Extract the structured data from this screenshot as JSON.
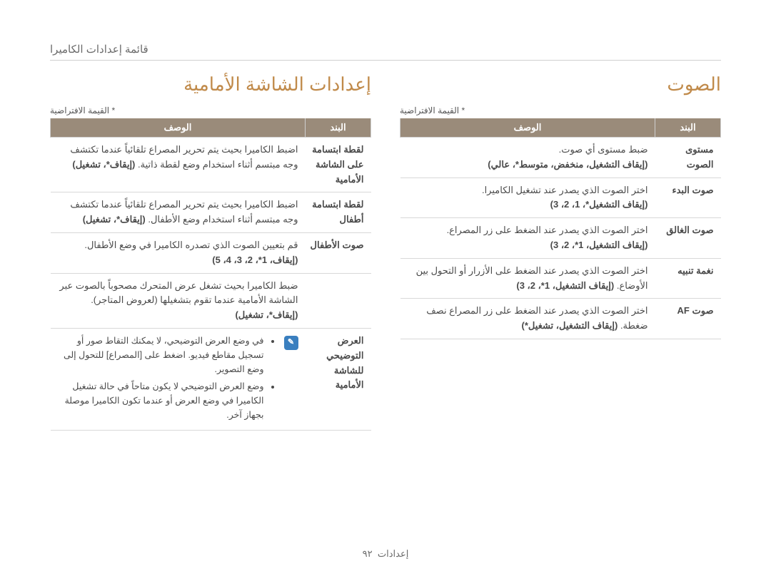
{
  "breadcrumb": "قائمة إعدادات الكاميرا",
  "default_note": "* القيمة الافتراضية",
  "headers": {
    "item": "البند",
    "desc": "الوصف"
  },
  "sound": {
    "title": "الصوت",
    "rows": [
      {
        "item": "مستوى الصوت",
        "desc": "ضبط مستوى أي صوت.",
        "options": "(إيقاف التشغيل، منخفض، متوسط*، عالي)"
      },
      {
        "item": "صوت البدء",
        "desc": "اختر الصوت الذي يصدر عند تشغيل الكاميرا.",
        "options": "(إيقاف التشغيل*، 1، 2، 3)"
      },
      {
        "item": "صوت الغالق",
        "desc": "اختر الصوت الذي يصدر عند الضغط على زر المصراع.",
        "options": "(إيقاف التشغيل، 1*، 2، 3)"
      },
      {
        "item": "نغمة تنبيه",
        "desc": "اختر الصوت الذي يصدر عند الضغط على الأزرار أو التحول بين الأوضاع.",
        "options": "(إيقاف التشغيل، 1*، 2، 3)"
      },
      {
        "item": "صوت AF",
        "desc": "اختر الصوت الذي يصدر عند الضغط على زر المصراع نصف ضغطة.",
        "options": "(إيقاف التشغيل، تشغيل*)"
      }
    ]
  },
  "front": {
    "title": "إعدادات الشاشة الأمامية",
    "rows": [
      {
        "item": "لقطة ابتسامة على الشاشة الأمامية",
        "desc": "اضبط الكاميرا بحيث يتم تحرير المصراع تلقائياً عندما تكتشف وجه مبتسم أثناء استخدام وضع لقطة ذاتية.",
        "options": "(إيقاف*، تشغيل)"
      },
      {
        "item": "لقطة ابتسامة أطفال",
        "desc": "اضبط الكاميرا بحيث يتم تحرير المصراع تلقائياً عندما تكتشف وجه مبتسم أثناء استخدام وضع الأطفال.",
        "options": "(إيقاف*، تشغيل)"
      },
      {
        "item": "صوت الأطفال",
        "desc": "قم بتعيين الصوت الذي تصدره الكاميرا في وضع الأطفال.",
        "options": "(إيقاف، 1*، 2، 3، 4، 5)"
      },
      {
        "item_blank": true,
        "desc": "ضبط الكاميرا بحيث تشغل عرض المتحرك مصحوباً بالصوت عبر الشاشة الأمامية عندما تقوم بتشغيلها (لعروض المتاجر).",
        "options": "(إيقاف*، تشغيل)"
      }
    ],
    "demo_item": "العرض التوضيحي للشاشة الأمامية",
    "notes": [
      "في وضع العرض التوضيحي، لا يمكنك التقاط صور أو تسجيل مقاطع فيديو. اضغط على [المصراع] للتحول إلى وضع التصوير.",
      "وضع العرض التوضيحي لا يكون متاحاً في حالة تشغيل الكاميرا في وضع العرض أو عندما تكون الكاميرا موصلة بجهاز آخر."
    ]
  },
  "footer": {
    "label": "إعدادات",
    "page": "٩٢"
  }
}
